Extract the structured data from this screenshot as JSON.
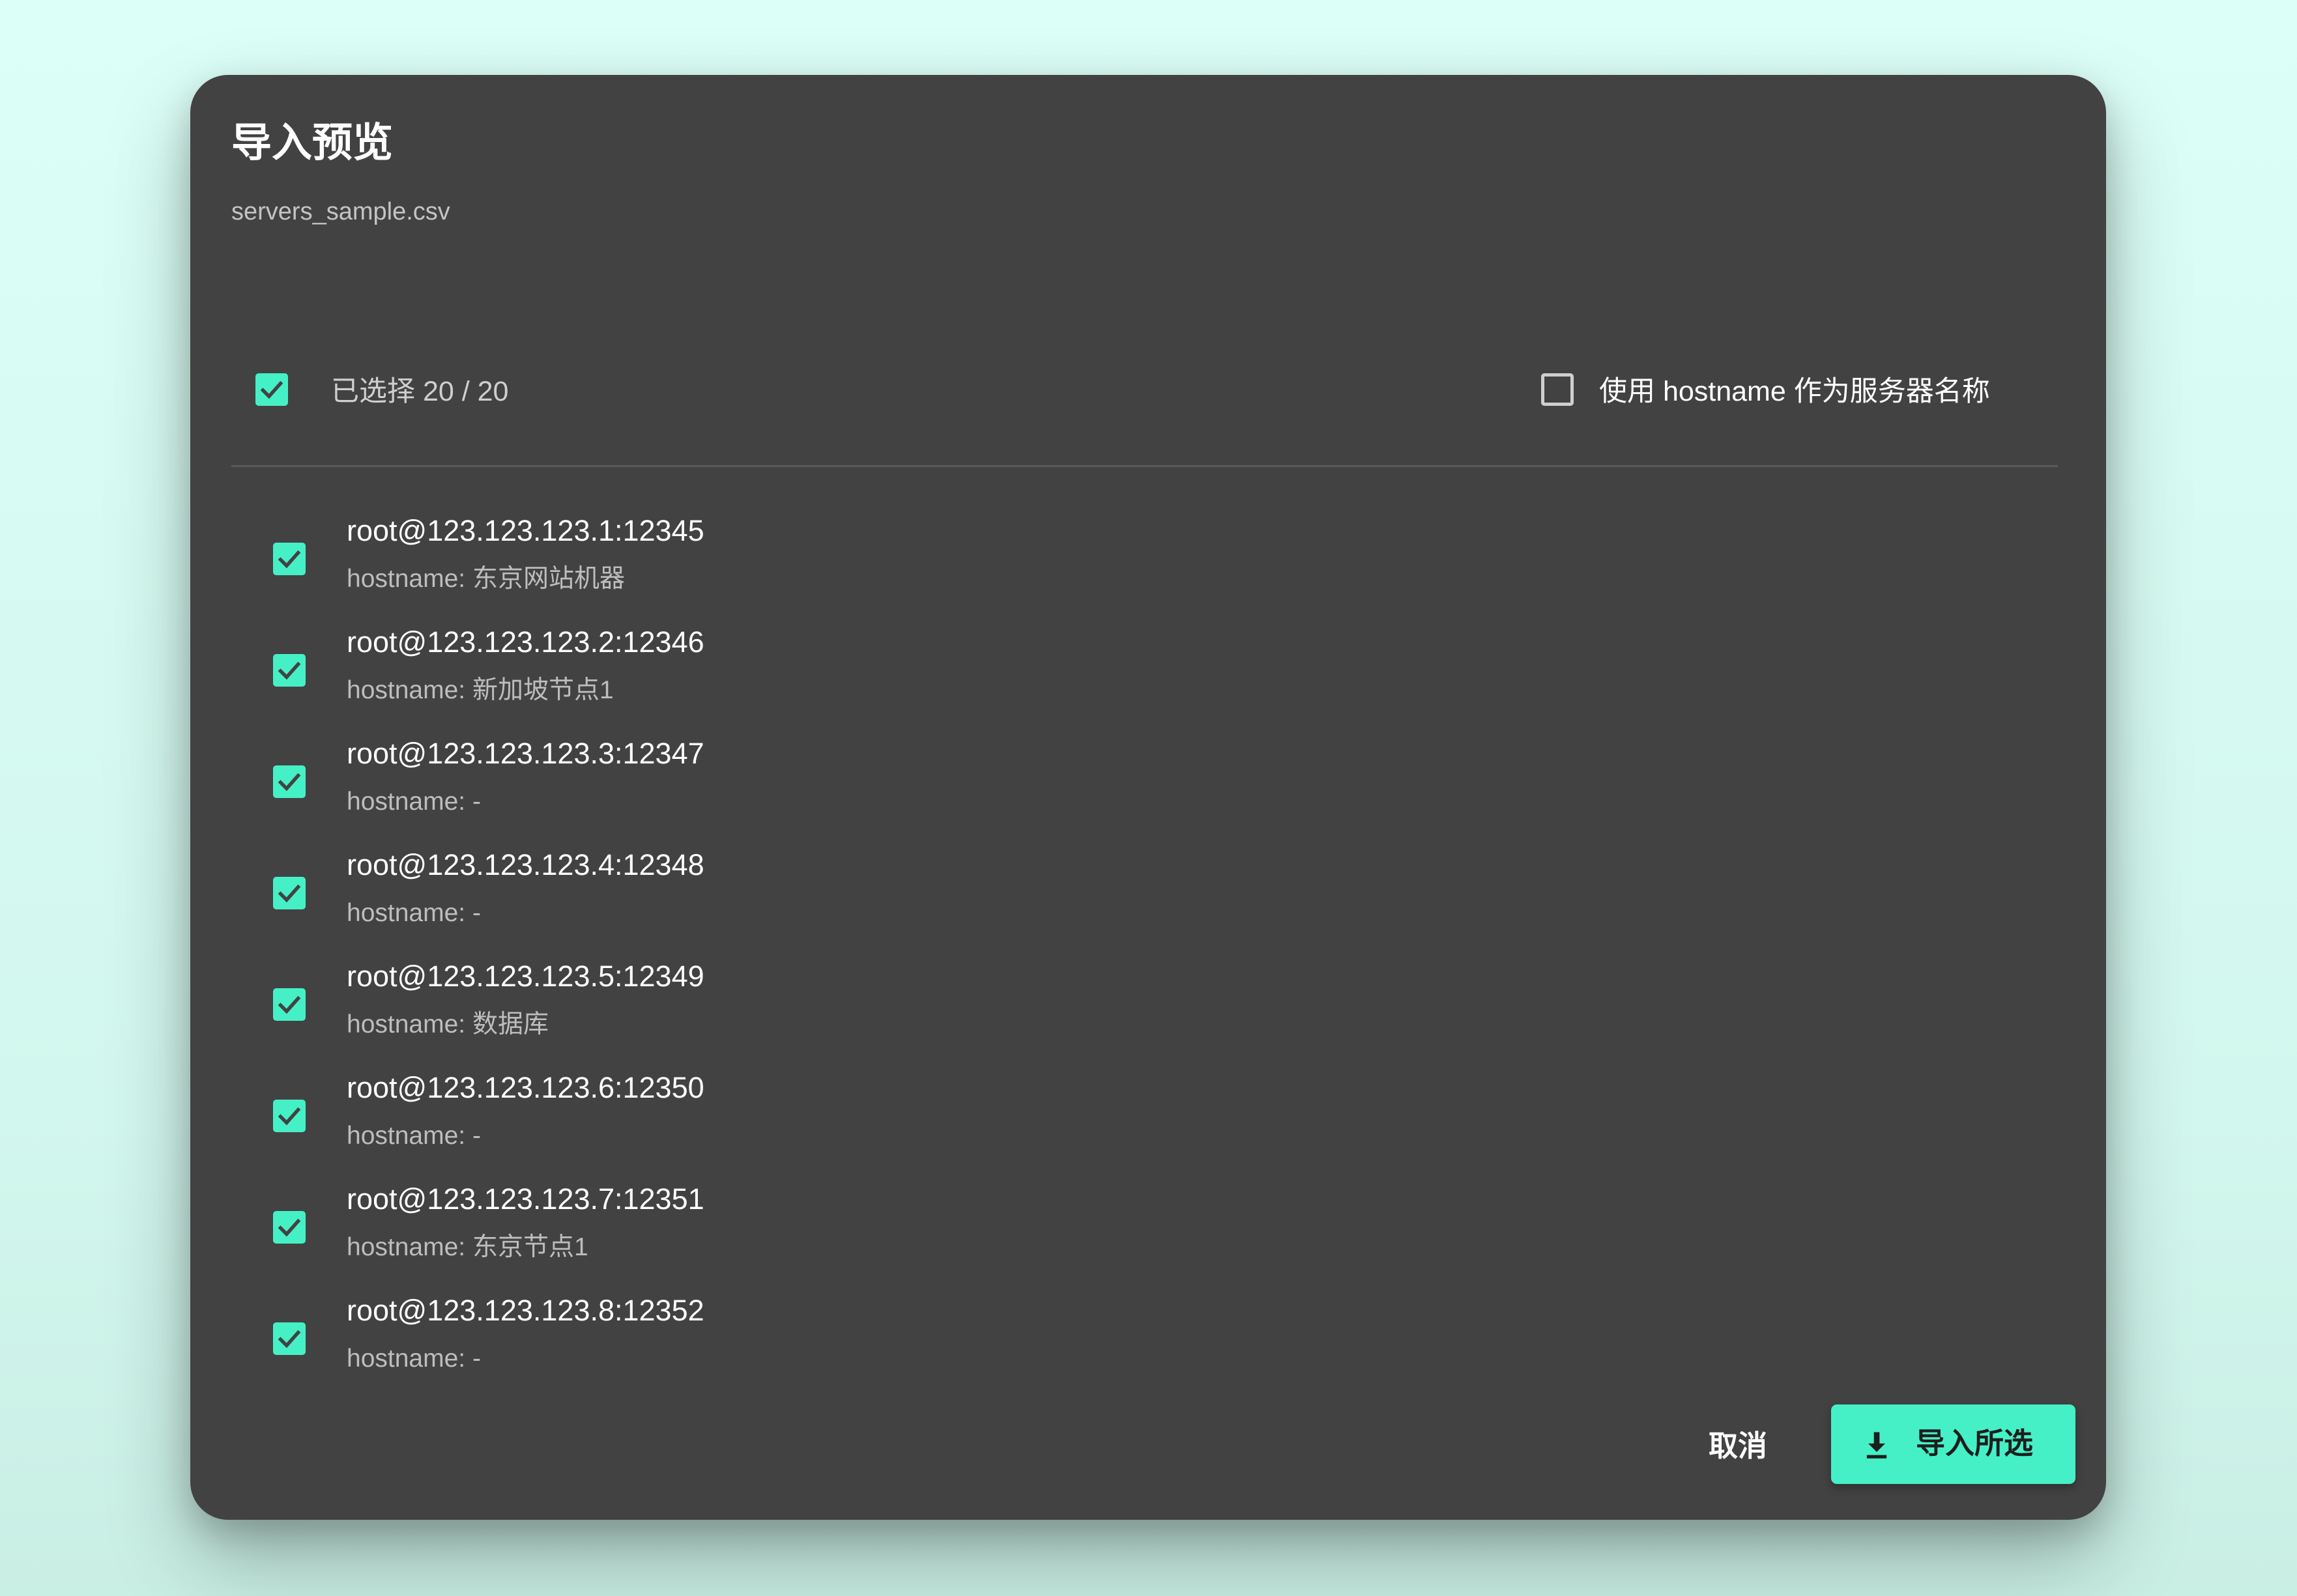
{
  "dialog": {
    "title": "导入预览",
    "filename": "servers_sample.csv"
  },
  "toolbar": {
    "select_all_checked": true,
    "select_all_label": "已选择 20 / 20",
    "use_hostname_checked": false,
    "use_hostname_label": "使用 hostname 作为服务器名称"
  },
  "servers": [
    {
      "address": "root@123.123.123.1:12345",
      "hostname": "hostname: 东京网站机器",
      "checked": true
    },
    {
      "address": "root@123.123.123.2:12346",
      "hostname": "hostname: 新加坡节点1",
      "checked": true
    },
    {
      "address": "root@123.123.123.3:12347",
      "hostname": "hostname: -",
      "checked": true
    },
    {
      "address": "root@123.123.123.4:12348",
      "hostname": "hostname: -",
      "checked": true
    },
    {
      "address": "root@123.123.123.5:12349",
      "hostname": "hostname: 数据库",
      "checked": true
    },
    {
      "address": "root@123.123.123.6:12350",
      "hostname": "hostname: -",
      "checked": true
    },
    {
      "address": "root@123.123.123.7:12351",
      "hostname": "hostname: 东京节点1",
      "checked": true
    },
    {
      "address": "root@123.123.123.8:12352",
      "hostname": "hostname: -",
      "checked": true
    }
  ],
  "actions": {
    "cancel_label": "取消",
    "import_label": "导入所选",
    "import_icon": "download-icon"
  },
  "colors": {
    "accent": "#46f0c6",
    "dialog_bg": "#424242",
    "page_bg": "#dcfff7"
  }
}
